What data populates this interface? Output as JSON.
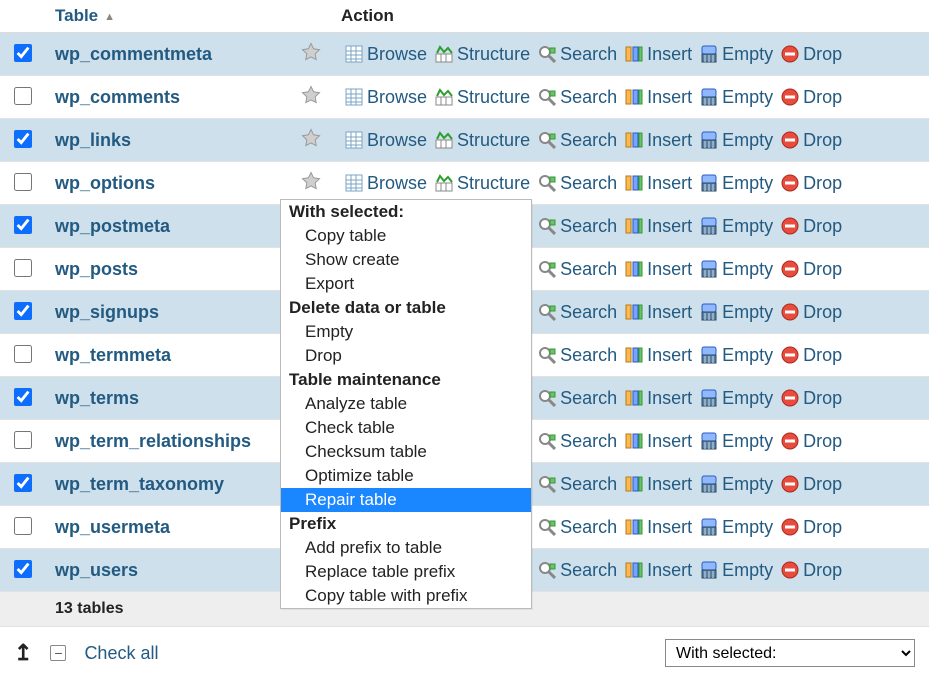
{
  "header": {
    "table_col": "Table",
    "action_col": "Action"
  },
  "actions": {
    "browse": "Browse",
    "structure": "Structure",
    "search": "Search",
    "insert": "Insert",
    "empty": "Empty",
    "drop": "Drop"
  },
  "rows": [
    {
      "name": "wp_commentmeta",
      "checked": true
    },
    {
      "name": "wp_comments",
      "checked": false
    },
    {
      "name": "wp_links",
      "checked": true
    },
    {
      "name": "wp_options",
      "checked": false
    },
    {
      "name": "wp_postmeta",
      "checked": true
    },
    {
      "name": "wp_posts",
      "checked": false
    },
    {
      "name": "wp_signups",
      "checked": true
    },
    {
      "name": "wp_termmeta",
      "checked": false
    },
    {
      "name": "wp_terms",
      "checked": true
    },
    {
      "name": "wp_term_relationships",
      "checked": false
    },
    {
      "name": "wp_term_taxonomy",
      "checked": true
    },
    {
      "name": "wp_usermeta",
      "checked": false
    },
    {
      "name": "wp_users",
      "checked": true
    }
  ],
  "summary": {
    "label": "13 tables"
  },
  "bottom": {
    "checkall": "Check all",
    "with_selected": "With selected:"
  },
  "context_menu": {
    "with_selected_hdr": "With selected:",
    "copy_table": "Copy table",
    "show_create": "Show create",
    "export": "Export",
    "delete_hdr": "Delete data or table",
    "empty": "Empty",
    "drop": "Drop",
    "maint_hdr": "Table maintenance",
    "analyze": "Analyze table",
    "check": "Check table",
    "checksum": "Checksum table",
    "optimize": "Optimize table",
    "repair": "Repair table",
    "prefix_hdr": "Prefix",
    "add_prefix": "Add prefix to table",
    "replace_prefix": "Replace table prefix",
    "copy_prefix": "Copy table with prefix"
  }
}
